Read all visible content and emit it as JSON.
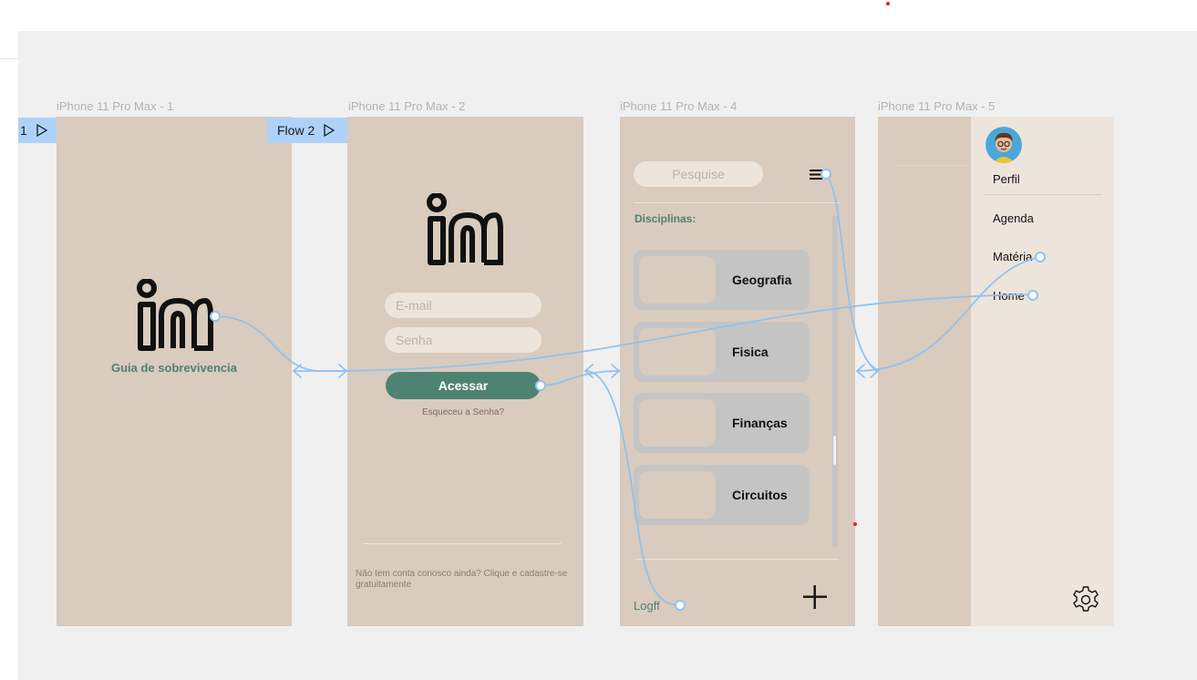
{
  "canvas": {
    "background": "#f0f0f0",
    "frame_color": "#d9cbbd",
    "accent": "#4e8273",
    "connector_color": "#8fc3f0"
  },
  "frames": [
    {
      "label": "iPhone 11 Pro Max - 1"
    },
    {
      "label": "iPhone 11 Pro Max - 2"
    },
    {
      "label": "iPhone 11 Pro Max - 4"
    },
    {
      "label": "iPhone 11 Pro Max - 5"
    }
  ],
  "flows": [
    {
      "label": "1"
    },
    {
      "label": "Flow 2"
    }
  ],
  "screen1": {
    "logo_icon": "linkedin-in-icon",
    "tagline": "Guia de sobrevivencia"
  },
  "screen2": {
    "logo_icon": "linkedin-in-icon",
    "email_placeholder": "E-mail",
    "password_placeholder": "Senha",
    "submit_label": "Acessar",
    "forgot_label": "Esqueceu a Senha?",
    "signup_text": "Não tem conta conosco ainda? Clique e cadastre-se gratuitamente"
  },
  "screen4": {
    "search_placeholder": "Pesquise",
    "menu_icon": "hamburger-icon",
    "section_title": "Disciplinas:",
    "subjects": [
      "Geografia",
      "Fisica",
      "Finanças",
      "Circuitos"
    ],
    "logout_label": "Logff",
    "add_icon": "plus-icon"
  },
  "screen5": {
    "avatar_icon": "avatar-icon",
    "menu": [
      "Perfil",
      "Agenda",
      "Matéria",
      "Home"
    ],
    "settings_icon": "gear-icon"
  }
}
